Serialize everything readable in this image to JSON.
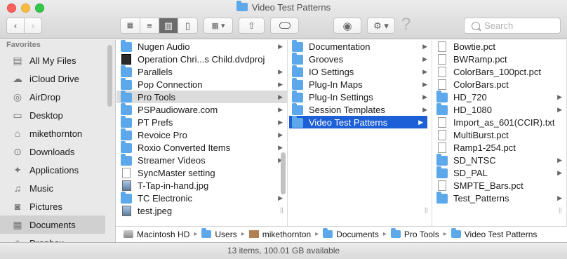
{
  "window": {
    "title": "Video Test Patterns"
  },
  "toolbar": {
    "back_icon": "chevron-left-icon",
    "forward_icon": "chevron-right-icon",
    "view_icons": [
      "icon-view-icon",
      "list-view-icon",
      "column-view-icon",
      "coverflow-view-icon"
    ],
    "arrange_icon": "arrange-icon",
    "share_icon": "share-icon",
    "tag_icon": "tag-icon",
    "quicklook_icon": "eye-icon",
    "action_icon": "gear-icon",
    "help_glyph": "?",
    "search_placeholder": "Search"
  },
  "sidebar": {
    "heading": "Favorites",
    "items": [
      {
        "label": "All My Files",
        "icon": "all-files-icon",
        "glyph": "▤"
      },
      {
        "label": "iCloud Drive",
        "icon": "cloud-icon",
        "glyph": "☁"
      },
      {
        "label": "AirDrop",
        "icon": "airdrop-icon",
        "glyph": "◎"
      },
      {
        "label": "Desktop",
        "icon": "desktop-icon",
        "glyph": "▭"
      },
      {
        "label": "mikethornton",
        "icon": "home-icon",
        "glyph": "⌂"
      },
      {
        "label": "Downloads",
        "icon": "download-icon",
        "glyph": "⊙"
      },
      {
        "label": "Applications",
        "icon": "applications-icon",
        "glyph": "✦"
      },
      {
        "label": "Music",
        "icon": "music-icon",
        "glyph": "♫"
      },
      {
        "label": "Pictures",
        "icon": "camera-icon",
        "glyph": "◙"
      },
      {
        "label": "Documents",
        "icon": "documents-icon",
        "glyph": "▦"
      },
      {
        "label": "Dropbox",
        "icon": "dropbox-icon",
        "glyph": "◇"
      }
    ],
    "selected": "Documents"
  },
  "column1": [
    {
      "label": "Nugen Audio",
      "type": "folder",
      "arrow": true
    },
    {
      "label": "Operation Chri...s Child.dvdproj",
      "type": "dvd",
      "arrow": false
    },
    {
      "label": "Parallels",
      "type": "folder",
      "arrow": true
    },
    {
      "label": "Pop Connection",
      "type": "folder",
      "arrow": true
    },
    {
      "label": "Pro Tools",
      "type": "folder",
      "arrow": true
    },
    {
      "label": "PSPaudioware.com",
      "type": "folder",
      "arrow": true
    },
    {
      "label": "PT Prefs",
      "type": "folder",
      "arrow": true
    },
    {
      "label": "Revoice Pro",
      "type": "folder",
      "arrow": true
    },
    {
      "label": "Roxio Converted Items",
      "type": "folder",
      "arrow": true
    },
    {
      "label": "Streamer Videos",
      "type": "folder",
      "arrow": true
    },
    {
      "label": "SyncMaster setting",
      "type": "doc",
      "arrow": false
    },
    {
      "label": "T-Tap-in-hand.jpg",
      "type": "image",
      "arrow": false
    },
    {
      "label": "TC Electronic",
      "type": "folder",
      "arrow": true
    },
    {
      "label": "test.jpeg",
      "type": "image",
      "arrow": false
    }
  ],
  "column1_selected": "Pro Tools",
  "column2": [
    {
      "label": "Documentation",
      "type": "folder",
      "arrow": true
    },
    {
      "label": "Grooves",
      "type": "folder",
      "arrow": true
    },
    {
      "label": "IO Settings",
      "type": "folder",
      "arrow": true
    },
    {
      "label": "Plug-In Maps",
      "type": "folder",
      "arrow": true
    },
    {
      "label": "Plug-In Settings",
      "type": "folder",
      "arrow": true
    },
    {
      "label": "Session Templates",
      "type": "folder",
      "arrow": true
    },
    {
      "label": "Video Test Patterns",
      "type": "folder",
      "arrow": true
    }
  ],
  "column2_selected": "Video Test Patterns",
  "column3": [
    {
      "label": "Bowtie.pct",
      "type": "doc",
      "arrow": false
    },
    {
      "label": "BWRamp.pct",
      "type": "doc",
      "arrow": false
    },
    {
      "label": "ColorBars_100pct.pct",
      "type": "doc",
      "arrow": false
    },
    {
      "label": "ColorBars.pct",
      "type": "doc",
      "arrow": false
    },
    {
      "label": "HD_720",
      "type": "folder",
      "arrow": true
    },
    {
      "label": "HD_1080",
      "type": "folder",
      "arrow": true
    },
    {
      "label": "Import_as_601(CCIR).txt",
      "type": "doc",
      "arrow": false
    },
    {
      "label": "MultiBurst.pct",
      "type": "doc",
      "arrow": false
    },
    {
      "label": "Ramp1-254.pct",
      "type": "doc",
      "arrow": false
    },
    {
      "label": "SD_NTSC",
      "type": "folder",
      "arrow": true
    },
    {
      "label": "SD_PAL",
      "type": "folder",
      "arrow": true
    },
    {
      "label": "SMPTE_Bars.pct",
      "type": "doc",
      "arrow": false
    },
    {
      "label": "Test_Patterns",
      "type": "folder",
      "arrow": true
    }
  ],
  "pathbar": [
    {
      "label": "Macintosh HD",
      "icon": "hard-drive-icon"
    },
    {
      "label": "Users",
      "icon": "folder-icon"
    },
    {
      "label": "mikethornton",
      "icon": "home-icon"
    },
    {
      "label": "Documents",
      "icon": "folder-icon"
    },
    {
      "label": "Pro Tools",
      "icon": "folder-icon"
    },
    {
      "label": "Video Test Patterns",
      "icon": "folder-icon"
    }
  ],
  "status": {
    "text": "13 items, 100.01 GB available"
  },
  "colors": {
    "folder": "#5ca8ea",
    "selection_blue": "#1c5fd7",
    "selection_grey": "#dcdcdc"
  }
}
